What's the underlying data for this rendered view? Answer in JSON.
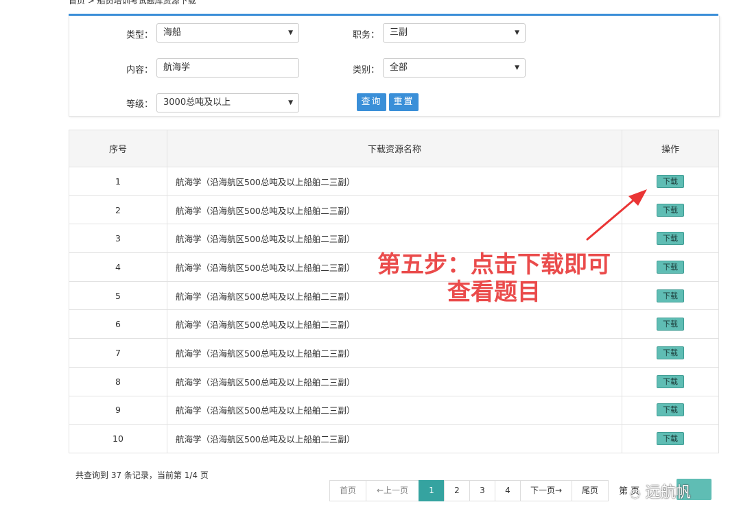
{
  "breadcrumb": "首页 > 船员培训考试题库资源下载",
  "filters": {
    "type_label": "类型：",
    "type_value": "海船",
    "position_label": "职务：",
    "position_value": "三副",
    "content_label": "内容：",
    "content_value": "航海学",
    "category_label": "类别：",
    "category_value": "全部",
    "grade_label": "等级：",
    "grade_value": "3000总吨及以上",
    "query_button": "查询",
    "reset_button": "重置"
  },
  "table": {
    "headers": [
      "序号",
      "下载资源名称",
      "操作"
    ],
    "rows": [
      {
        "no": "1",
        "name": "航海学（沿海航区500总吨及以上船舶二三副）",
        "action": "下载"
      },
      {
        "no": "2",
        "name": "航海学（沿海航区500总吨及以上船舶二三副）",
        "action": "下载"
      },
      {
        "no": "3",
        "name": "航海学（沿海航区500总吨及以上船舶二三副）",
        "action": "下载"
      },
      {
        "no": "4",
        "name": "航海学（沿海航区500总吨及以上船舶二三副）",
        "action": "下载"
      },
      {
        "no": "5",
        "name": "航海学（沿海航区500总吨及以上船舶二三副）",
        "action": "下载"
      },
      {
        "no": "6",
        "name": "航海学（沿海航区500总吨及以上船舶二三副）",
        "action": "下载"
      },
      {
        "no": "7",
        "name": "航海学（沿海航区500总吨及以上船舶二三副）",
        "action": "下载"
      },
      {
        "no": "8",
        "name": "航海学（沿海航区500总吨及以上船舶二三副）",
        "action": "下载"
      },
      {
        "no": "9",
        "name": "航海学（沿海航区500总吨及以上船舶二三副）",
        "action": "下载"
      },
      {
        "no": "10",
        "name": "航海学（沿海航区500总吨及以上船舶二三副）",
        "action": "下载"
      }
    ]
  },
  "summary": "共查询到 37 条记录，当前第 1/4 页",
  "pagination": {
    "first": "首页",
    "prev": "←上一页",
    "pages": [
      "1",
      "2",
      "3",
      "4"
    ],
    "current_page": "1",
    "next": "下一页→",
    "last": "尾页",
    "tail_text": "第 页"
  },
  "annotation": {
    "line1": "第五步：点击下载即可",
    "line2": "查看题目",
    "color": "#ea4b4b"
  },
  "watermark": "远航帆",
  "colors": {
    "accent_blue": "#3a8fd8",
    "teal": "#5fbdb4",
    "active_page": "#35a3a0"
  },
  "icons": {
    "dropdown": "chevron-down-icon",
    "arrow": "red-arrow-icon",
    "watermark_logo": "wechat-bubble-icon"
  }
}
